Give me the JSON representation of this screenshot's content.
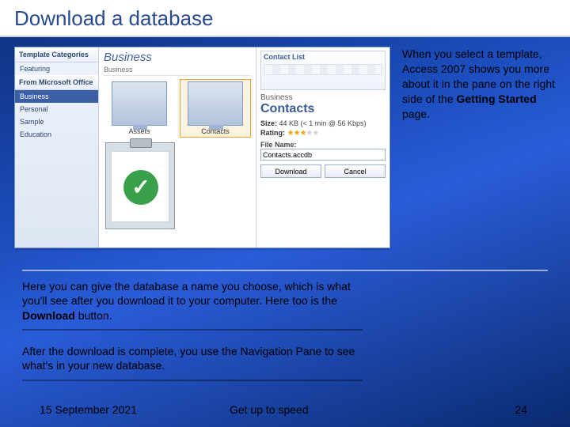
{
  "title": "Download a database",
  "sidebar": {
    "header": "Template Categories",
    "featuring": "Featuring",
    "from_ms": "From Microsoft Office",
    "items": [
      "Business",
      "Personal",
      "Sample",
      "Education"
    ],
    "selected_index": 0
  },
  "gallery": {
    "header": "Business",
    "sub": "Business",
    "templates": [
      {
        "label": "Assets"
      },
      {
        "label": "Contacts"
      }
    ],
    "selected_index": 1
  },
  "detail": {
    "preview_title": "Contact List",
    "category": "Business",
    "name": "Contacts",
    "size_label": "Size:",
    "size_value": "44 KB (< 1 min @ 56 Kbps)",
    "rating_label": "Rating:",
    "rating_value": 3,
    "filename_label": "File Name:",
    "filename_value": "Contacts.accdb",
    "download_label": "Download",
    "cancel_label": "Cancel"
  },
  "right_text": {
    "t1": "When you select a template, Access 2007 shows you more about it in the pane on the right side of the ",
    "bold": "Getting Started",
    "t2": " page."
  },
  "para1": {
    "a": "Here you can give the database a name you choose, which is what you'll see after you download it to your computer. Here too is the ",
    "b": "Download",
    "c": " button."
  },
  "para2": "After the download is complete, you use the Navigation Pane to see what's in your new database.",
  "footer": {
    "date": "15 September 2021",
    "center": "Get up to speed",
    "page": "24"
  }
}
